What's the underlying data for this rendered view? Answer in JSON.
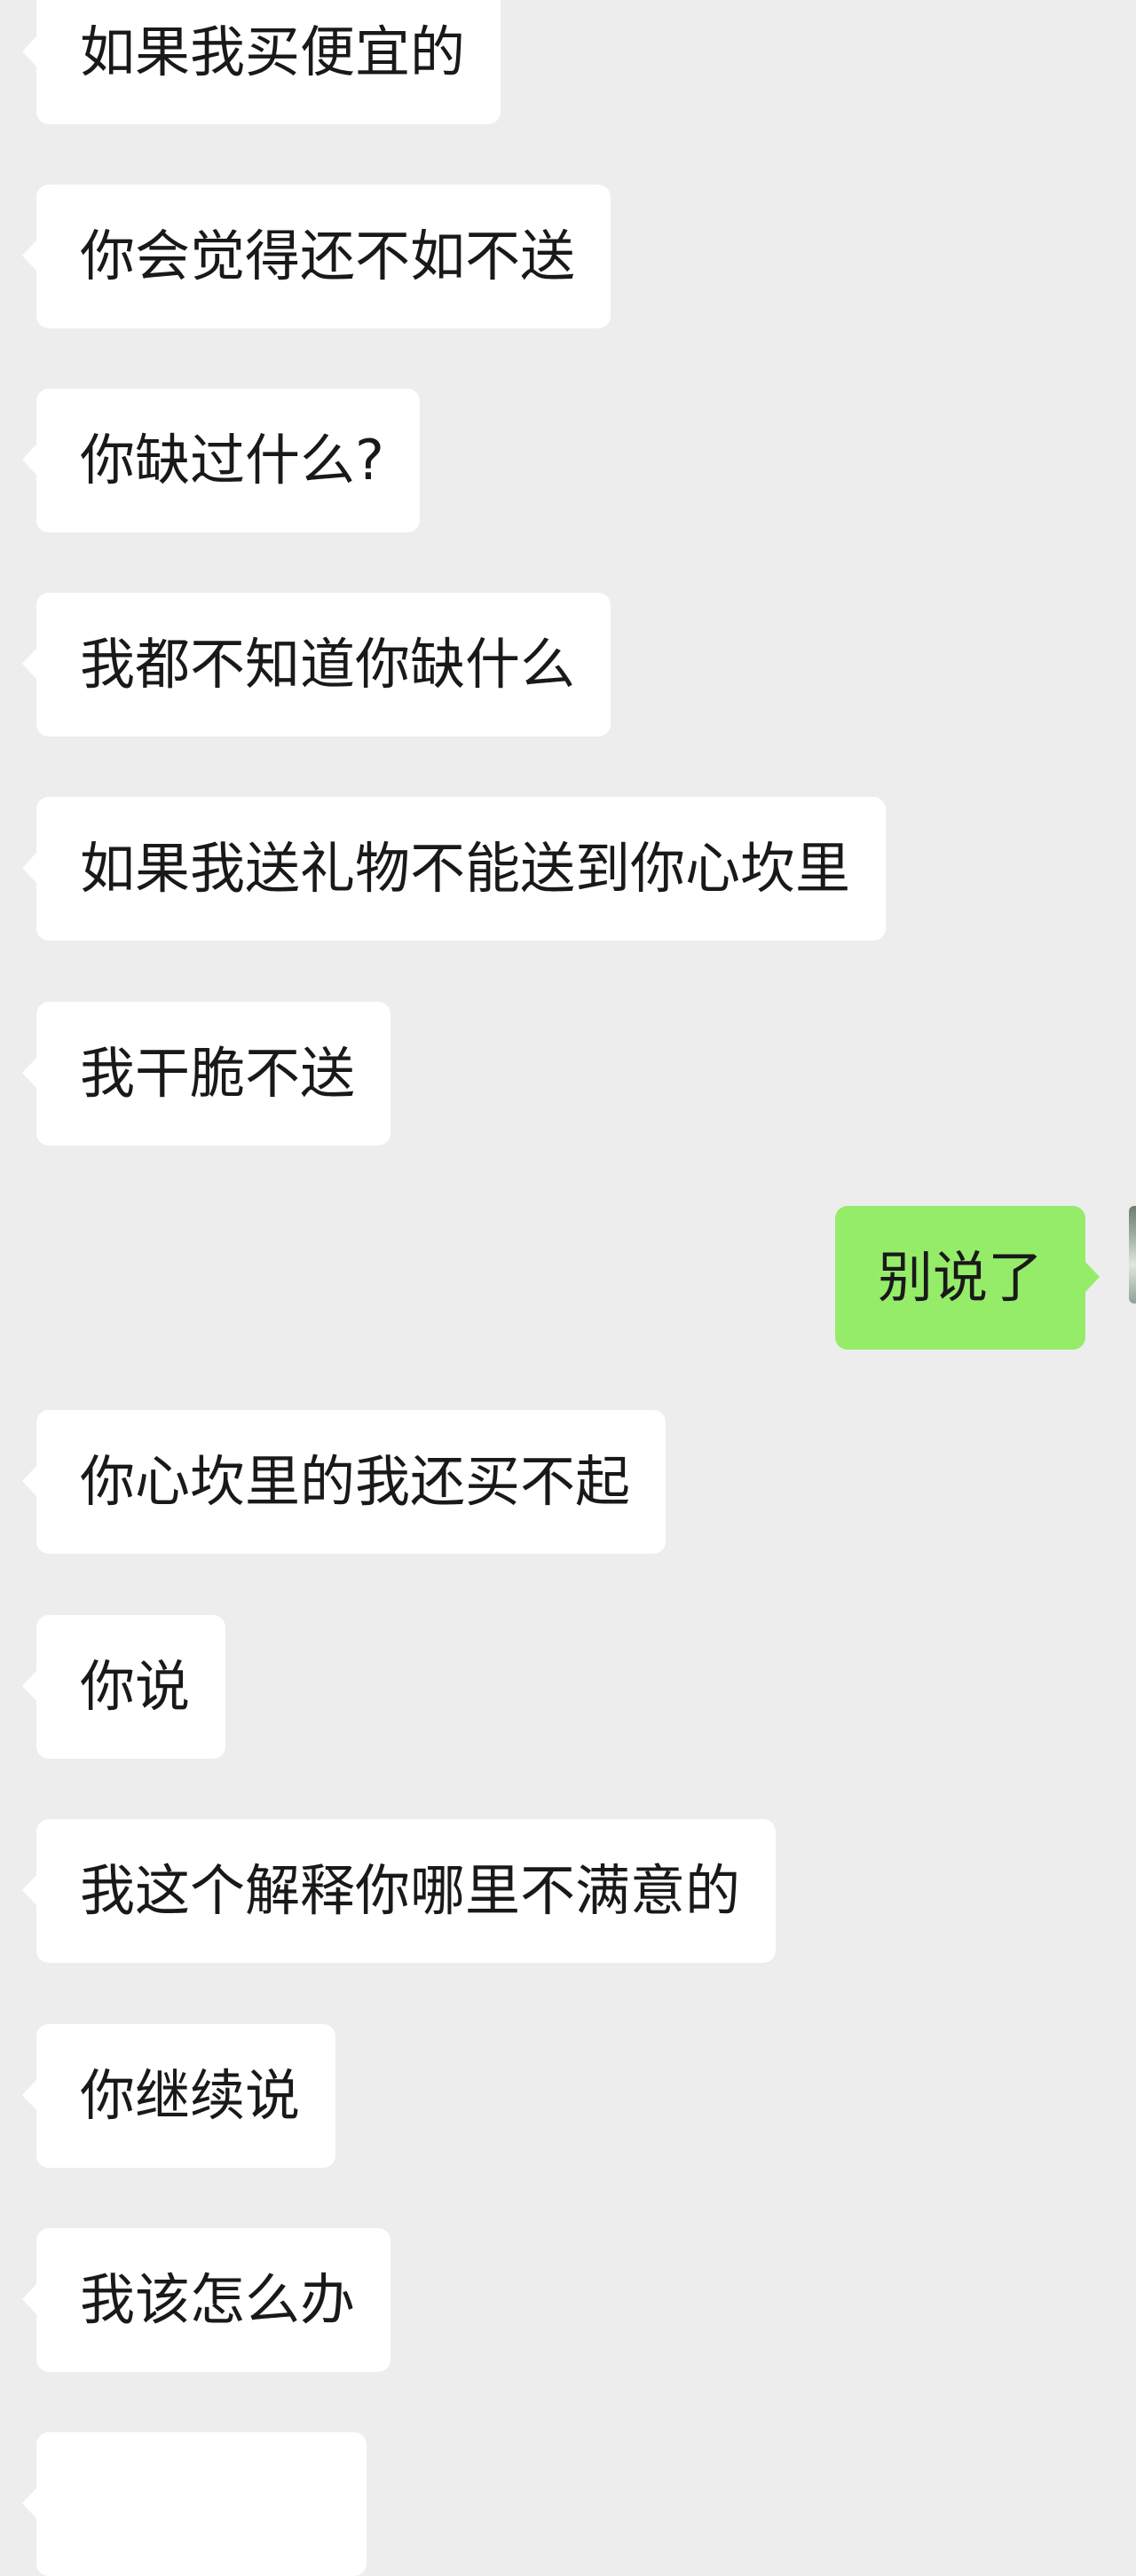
{
  "messages": [
    {
      "side": "left",
      "text": "如果我买便宜的"
    },
    {
      "side": "left",
      "text": "你会觉得还不如不送"
    },
    {
      "side": "left",
      "text": "你缺过什么?"
    },
    {
      "side": "left",
      "text": "我都不知道你缺什么"
    },
    {
      "side": "left",
      "text": "如果我送礼物不能送到你心坎里"
    },
    {
      "side": "left",
      "text": "我干脆不送"
    },
    {
      "side": "right",
      "text": "别说了"
    },
    {
      "side": "left",
      "text": "你心坎里的我还买不起"
    },
    {
      "side": "left",
      "text": "你说"
    },
    {
      "side": "left",
      "text": "我这个解释你哪里不满意的"
    },
    {
      "side": "left",
      "text": "你继续说"
    },
    {
      "side": "left",
      "text": "我该怎么办"
    },
    {
      "side": "left",
      "text": ""
    }
  ],
  "colors": {
    "background": "#ededed",
    "incoming_bubble": "#ffffff",
    "outgoing_bubble": "#95ec69",
    "text": "#191919"
  }
}
